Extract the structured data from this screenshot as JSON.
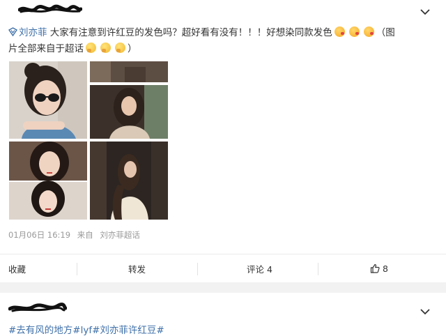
{
  "post1": {
    "author_link": "刘亦菲",
    "body_line1": " 大家有注意到许红豆的发色吗？超好看有没有！！！好想染同款发色",
    "body_line2_open": "（图",
    "body_line2": "片全部来自于超话",
    "body_line2_close": "）",
    "emojis_line1": [
      "kiss-emoji",
      "kiss-emoji",
      "kiss-emoji"
    ],
    "emojis_line2": [
      "thinking-emoji",
      "thinking-emoji",
      "thinking-emoji"
    ],
    "date": "01月06日 16:19",
    "source_prefix": "来自",
    "source": "刘亦菲超话",
    "photos": [
      {
        "name": "photo-sunglasses"
      },
      {
        "name": "photo-evening-pair"
      },
      {
        "name": "photo-portrait-pair"
      },
      {
        "name": "photo-standing"
      }
    ]
  },
  "actions": {
    "favorite": "收藏",
    "repost": "转发",
    "comment": "评论 4",
    "like_count": "8"
  },
  "post2": {
    "topics": "#去有风的地方#lyf#刘亦菲许红豆#"
  },
  "icons": {
    "chevron": "chevron-down-icon",
    "supertopic": "supertopic-tag-icon",
    "like": "thumb-up-icon"
  },
  "colors": {
    "link": "#3d6fa8",
    "meta": "#999999",
    "background": "#f2f2f2"
  }
}
